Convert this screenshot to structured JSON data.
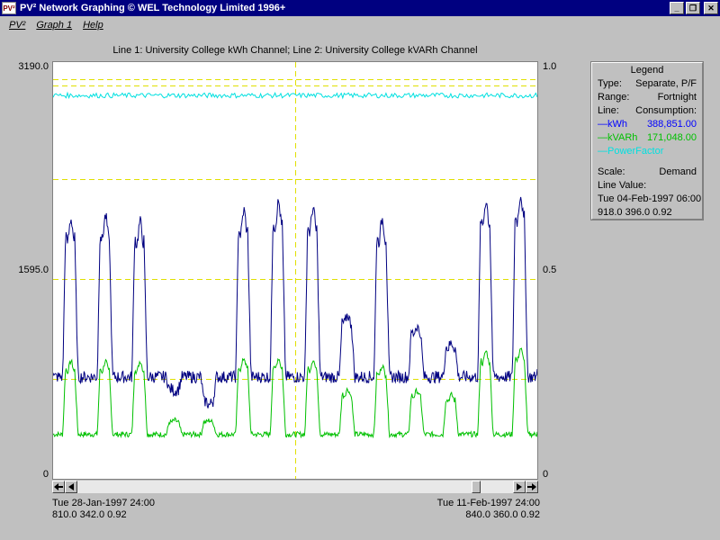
{
  "window": {
    "icon_text": "PV²",
    "title": "PV² Network Graphing © WEL Technology Limited 1996+",
    "minimize": "_",
    "maximize": "❐",
    "close": "✕"
  },
  "menu": {
    "items": [
      "PV²",
      "Graph 1",
      "Help"
    ]
  },
  "chart_title": "Line  1: University College kWh Channel; Line  2: University College kVARh Channel",
  "axes": {
    "left_ticks": [
      "3190.0",
      "1595.0",
      "0"
    ],
    "right_ticks": [
      "1.0",
      "0.5",
      "0"
    ]
  },
  "footer": {
    "left_date": "Tue 28-Jan-1997 24:00",
    "left_values": "810.0 342.0 0.92",
    "right_date": "Tue 11-Feb-1997 24:00",
    "right_values": "840.0 360.0 0.92"
  },
  "legend": {
    "title": "Legend",
    "type_label": "Type:",
    "type_value": "Separate, P/F",
    "range_label": "Range:",
    "range_value": "Fortnight",
    "line_label": "Line:",
    "line_value": "Consumption:",
    "kwh_label": "—kWh",
    "kwh_value": "388,851.00",
    "kvarh_label": "—kVARh",
    "kvarh_value": "171,048.00",
    "pf_label": "—PowerFactor",
    "scale_label": "Scale:",
    "scale_value": "Demand",
    "line_value_label": "Line Value:",
    "cursor_date": "Tue 04-Feb-1997 06:00",
    "cursor_values": "918.0 396.0 0.92"
  },
  "colors": {
    "kwh": "#000080",
    "kvarh": "#00c000",
    "pf": "#00e0e0",
    "grid": "#e0e000"
  },
  "chart_data": {
    "type": "line",
    "x_range": [
      "Tue 28-Jan-1997 24:00",
      "Tue 11-Feb-1997 24:00"
    ],
    "ylim_left": [
      0,
      3190
    ],
    "ylim_right": [
      0,
      1
    ],
    "series": [
      {
        "name": "kWh",
        "axis": "left",
        "start": 810,
        "end": 840,
        "cursor": 918,
        "daily_peaks": [
          1900,
          1920,
          1880,
          680,
          580,
          1960,
          2020,
          1980,
          1220,
          1900,
          1140,
          1020,
          2030,
          2070
        ],
        "night_base": 780
      },
      {
        "name": "kVARh",
        "axis": "left",
        "start": 342,
        "end": 360,
        "cursor": 396,
        "daily_peaks": [
          860,
          860,
          860,
          440,
          440,
          880,
          880,
          870,
          660,
          830,
          650,
          620,
          930,
          950
        ],
        "night_base": 340
      },
      {
        "name": "PowerFactor",
        "axis": "right",
        "value": 0.92
      }
    ],
    "grid": true
  }
}
